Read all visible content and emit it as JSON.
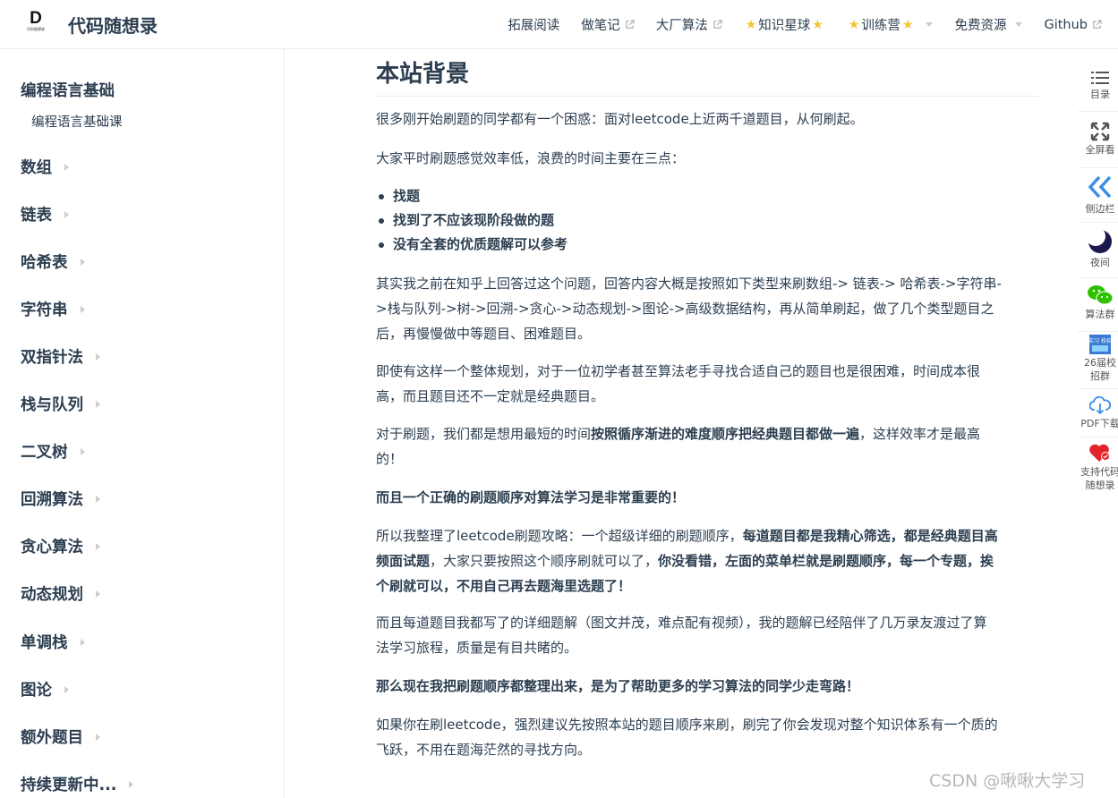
{
  "navbar": {
    "logo_text": "D",
    "logo_sub": "代码随想录",
    "site_name": "代码随想录",
    "links": [
      {
        "label": "拓展阅读"
      },
      {
        "label": "做笔记"
      },
      {
        "label": "大厂算法"
      },
      {
        "label": "知识星球"
      },
      {
        "label": "训练营"
      },
      {
        "label": "免费资源"
      },
      {
        "label": "Github"
      }
    ]
  },
  "sidebar": {
    "section_title": "编程语言基础",
    "section_sub": "编程语言基础课",
    "items": [
      {
        "label": "数组"
      },
      {
        "label": "链表"
      },
      {
        "label": "哈希表"
      },
      {
        "label": "字符串"
      },
      {
        "label": "双指针法"
      },
      {
        "label": "栈与队列"
      },
      {
        "label": "二叉树"
      },
      {
        "label": "回溯算法"
      },
      {
        "label": "贪心算法"
      },
      {
        "label": "动态规划"
      },
      {
        "label": "单调栈"
      },
      {
        "label": "图论"
      },
      {
        "label": "额外题目"
      },
      {
        "label": "持续更新中..."
      }
    ]
  },
  "content": {
    "title": "本站背景",
    "p1": "很多刚开始刷题的同学都有一个困惑：面对leetcode上近两千道题目，从何刷起。",
    "p2": "大家平时刷题感觉效率低，浪费的时间主要在三点：",
    "bullets": [
      "找题",
      "找到了不应该现阶段做的题",
      "没有全套的优质题解可以参考"
    ],
    "p3_line1": "其实我之前在知乎上回答过这个问题，回答内容大概是按照如下类型来刷数组-> 链表-> 哈希表->字符串-",
    "p3_line2": ">栈与队列->树->回溯->贪心->动态规划->图论->高级数据结构，再从简单刷起，做了几个类型题目之",
    "p3_line3": "后，再慢慢做中等题目、困难题目。",
    "p4_line1": "即使有这样一个整体规划，对于一位初学者甚至算法老手寻找合适自己的题目也是很困难，时间成本很",
    "p4_line2": "高，而且题目还不一定就是经典题目。",
    "p5_a": "对于刷题，我们都是想用最短的时间",
    "p5_b": "按照循序渐进的难度顺序把经典题目都做一遍",
    "p5_c": "，这样效率才是最高",
    "p5_d": "的！",
    "p6": "而且一个正确的刷题顺序对算法学习是非常重要的！",
    "p7_a": "所以我整理了leetcode刷题攻略：一个超级详细的刷题顺序，",
    "p7_b": "每道题目都是我精心筛选，都是经典题目高",
    "p7_c": "频面试题",
    "p7_d": "，大家只要按照这个顺序刷就可以了，",
    "p7_e": "你没看错，左面的菜单栏就是刷题顺序，每一个专题，挨",
    "p7_f": "个刷就可以，不用自己再去题海里选题了！",
    "p8_line1": "而且每道题目我都写了的详细题解（图文并茂，难点配有视频），我的题解已经陪伴了几万录友渡过了算",
    "p8_line2": "法学习旅程，质量是有目共睹的。",
    "p9": "那么现在我把刷题顺序都整理出来，是为了帮助更多的学习算法的同学少走弯路！",
    "p10_line1": "如果你在刷leetcode，强烈建议先按照本站的题目顺序来刷，刷完了你会发现对整个知识体系有一个质的",
    "p10_line2": "飞跃，不用在题海茫然的寻找方向。"
  },
  "toolbar": {
    "toc": "目录",
    "fullscreen": "全屏看",
    "sidebar": "侧边栏",
    "night": "夜间",
    "group": "算法群",
    "recruit_line1": "26届校",
    "recruit_line2": "招群",
    "recruit_icon_text": "实习 校招",
    "pdf": "PDF下载",
    "support_line1": "支持代码",
    "support_line2": "随想录"
  },
  "watermark": "CSDN @啾啾大学习",
  "colors": {
    "text": "#2c3e50",
    "star": "#f4c430",
    "sidebar_icon_blue": "#3a8ee6",
    "wechat_green": "#2dc100",
    "heart_red": "#e3242b"
  }
}
